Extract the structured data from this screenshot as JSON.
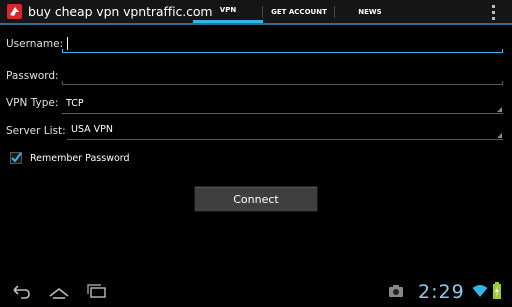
{
  "app": {
    "title": "buy cheap vpn vpntraffic.com"
  },
  "tabs": [
    {
      "label": "VPN",
      "selected": true
    },
    {
      "label": "GET ACCOUNT",
      "selected": false
    },
    {
      "label": "NEWS",
      "selected": false
    }
  ],
  "form": {
    "username_label": "Username:",
    "username_value": "",
    "password_label": "Password:",
    "password_value": "",
    "vpn_type_label": "VPN Type:",
    "vpn_type_value": "TCP",
    "server_list_label": "Server List:",
    "server_list_value": "USA VPN",
    "remember_label": "Remember Password",
    "remember_checked": true,
    "connect_label": "Connect"
  },
  "status_bar": {
    "time": "2:29",
    "icons": [
      "camera-icon",
      "wifi-icon",
      "battery-charging-icon"
    ]
  },
  "nav_bar": {
    "icons": [
      "back-icon",
      "home-icon",
      "recent-apps-icon"
    ]
  },
  "colors": {
    "accent": "#33b5e5",
    "background": "#000000",
    "action_bar": "#151515",
    "clock": "#8fc9e6",
    "app_icon_red": "#d9262b"
  }
}
